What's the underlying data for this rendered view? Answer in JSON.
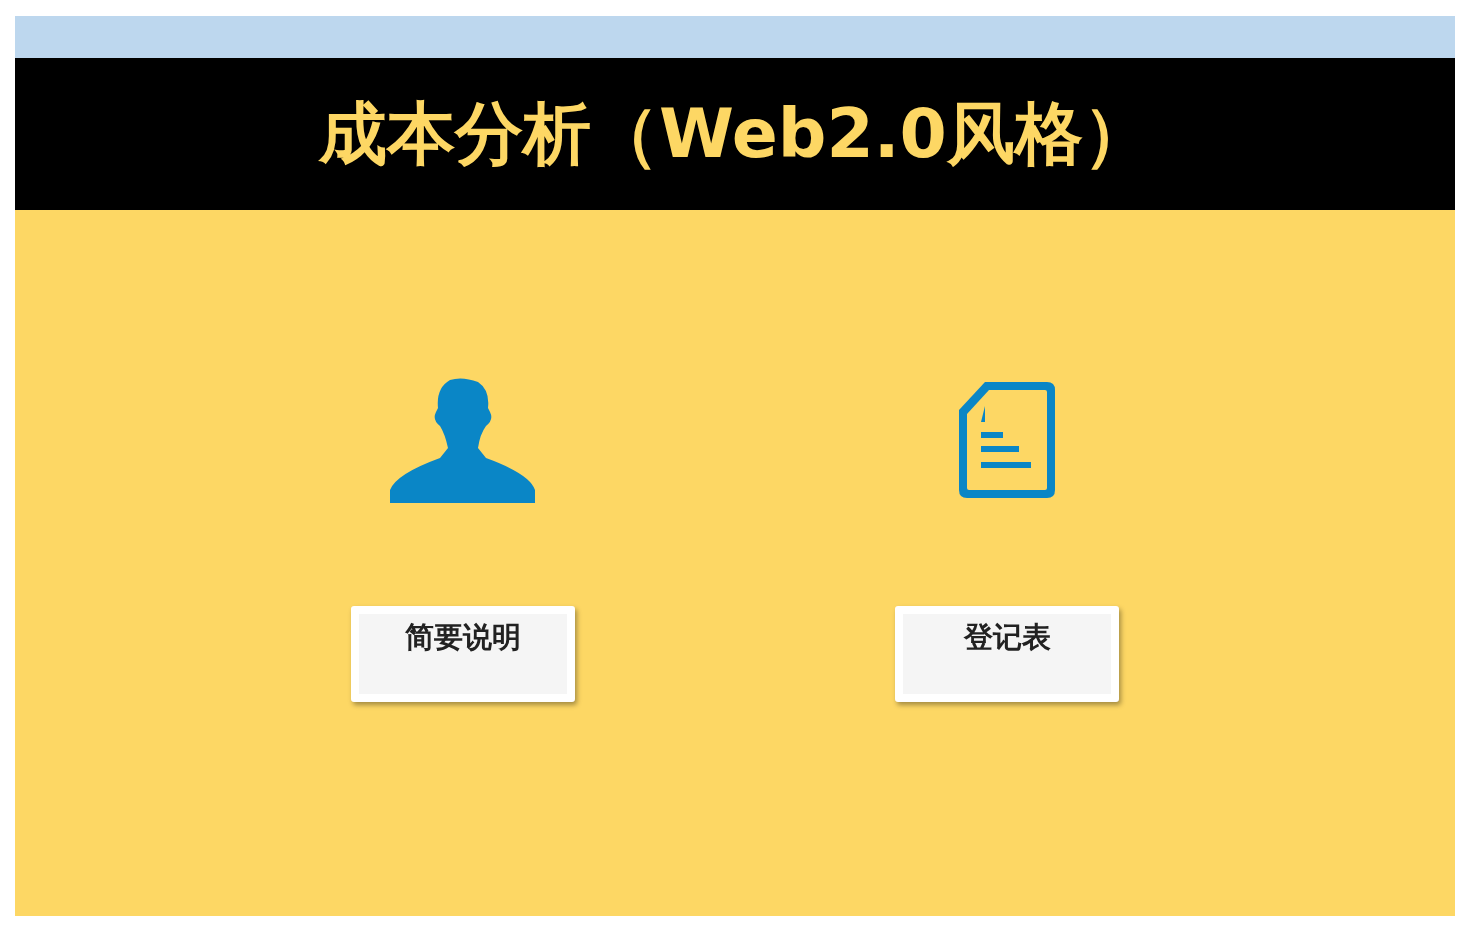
{
  "title": "成本分析（Web2.0风格）",
  "cards": [
    {
      "kind": "person",
      "label": "简要说明"
    },
    {
      "kind": "document",
      "label": "登记表"
    }
  ]
}
